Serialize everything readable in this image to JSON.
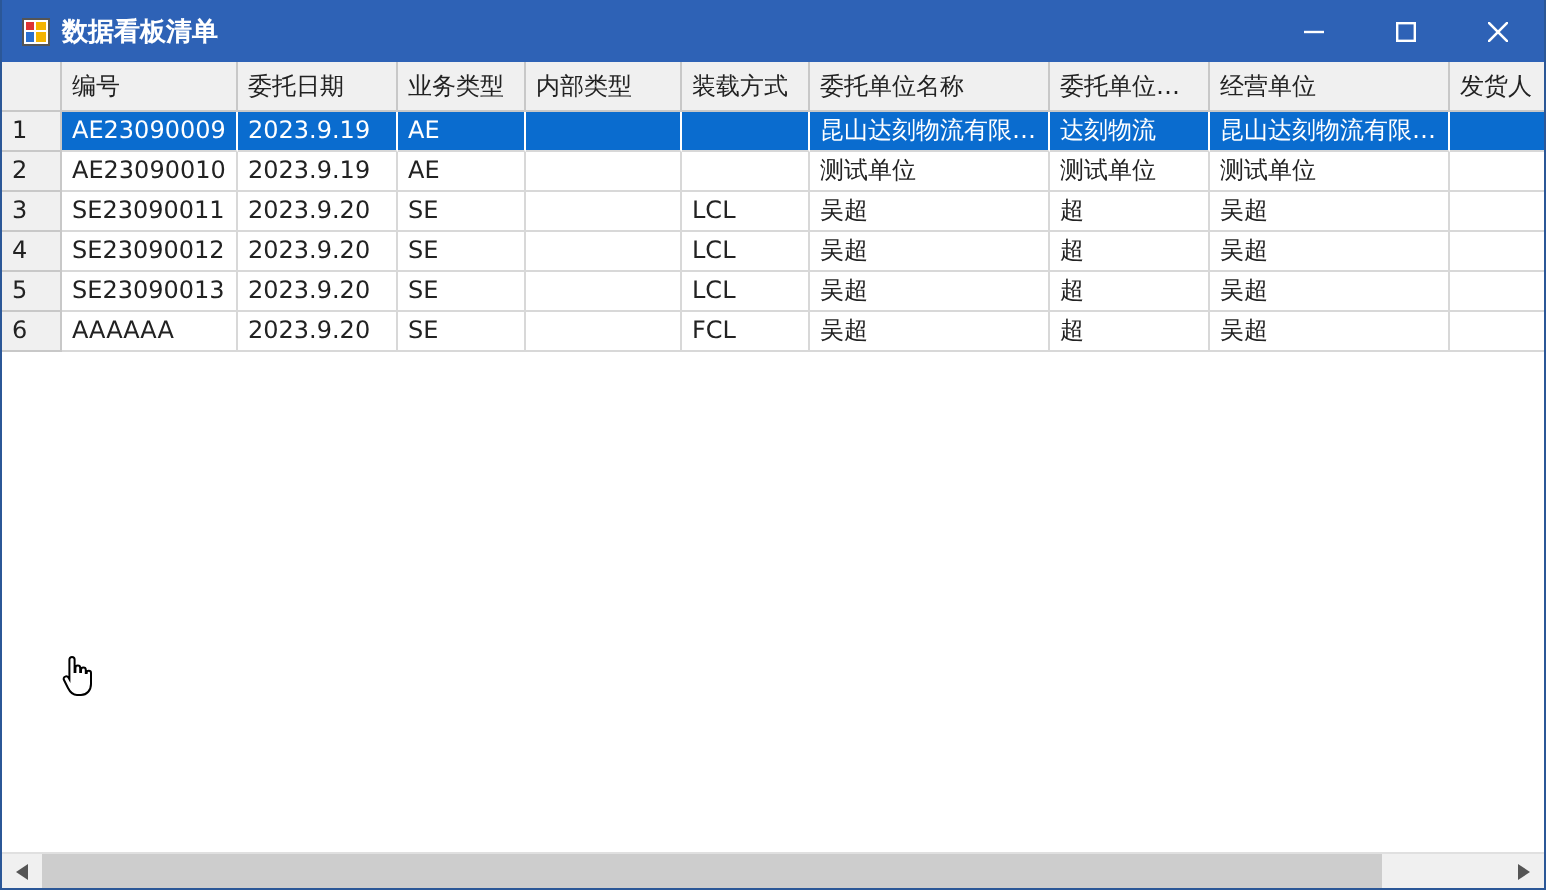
{
  "window": {
    "title": "数据看板清单"
  },
  "table": {
    "columns": [
      "编号",
      "委托日期",
      "业务类型",
      "内部类型",
      "装载方式",
      "委托单位名称",
      "委托单位…",
      "经营单位",
      "发货人"
    ],
    "rows": [
      {
        "number": "1",
        "selected": true,
        "cells": [
          "AE23090009",
          "2023.9.19",
          "AE",
          "",
          "",
          "昆山达刻物流有限…",
          "达刻物流",
          "昆山达刻物流有限…",
          ""
        ]
      },
      {
        "number": "2",
        "selected": false,
        "cells": [
          "AE23090010",
          "2023.9.19",
          "AE",
          "",
          "",
          "测试单位",
          "测试单位",
          "测试单位",
          ""
        ]
      },
      {
        "number": "3",
        "selected": false,
        "cells": [
          "SE23090011",
          "2023.9.20",
          "SE",
          "",
          "LCL",
          "吴超",
          "超",
          "吴超",
          ""
        ]
      },
      {
        "number": "4",
        "selected": false,
        "cells": [
          "SE23090012",
          "2023.9.20",
          "SE",
          "",
          "LCL",
          "吴超",
          "超",
          "吴超",
          ""
        ]
      },
      {
        "number": "5",
        "selected": false,
        "cells": [
          "SE23090013",
          "2023.9.20",
          "SE",
          "",
          "LCL",
          "吴超",
          "超",
          "吴超",
          ""
        ]
      },
      {
        "number": "6",
        "selected": false,
        "cells": [
          "AAAAAA",
          "2023.9.20",
          "SE",
          "",
          "FCL",
          "吴超",
          "超",
          "吴超",
          ""
        ]
      }
    ]
  }
}
